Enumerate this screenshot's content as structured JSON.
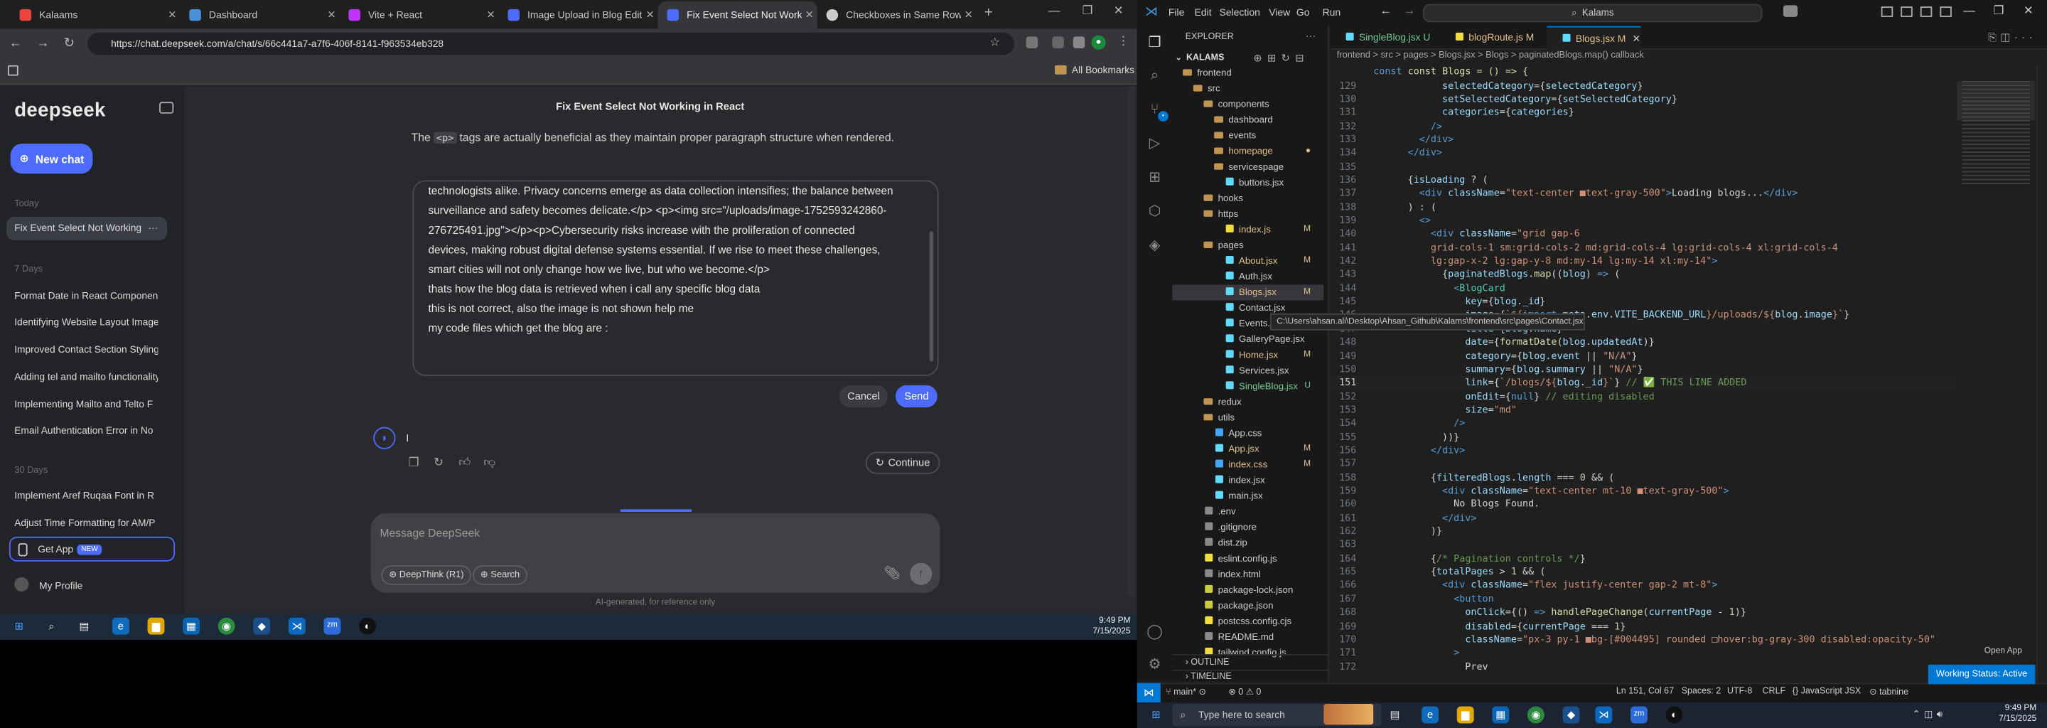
{
  "chrome": {
    "tabs": [
      {
        "title": "Kalaams",
        "color": "#e8453c"
      },
      {
        "title": "Dashboard",
        "color": "#4a90d9"
      },
      {
        "title": "Vite + React",
        "color": "#bd34fe"
      },
      {
        "title": "Image Upload in Blog Editor",
        "color": "#4d6bfe"
      },
      {
        "title": "Fix Event Select Not Working",
        "color": "#4d6bfe"
      },
      {
        "title": "Checkboxes in Same Row",
        "color": "#cccccc"
      }
    ],
    "url": "https://chat.deepseek.com/a/chat/s/66c441a7-a7f6-406f-8141-f963534eb328",
    "bookmarks_label": "All Bookmarks"
  },
  "deepseek": {
    "logo": "deepseek",
    "new_chat": "New chat",
    "groups": {
      "today": "Today",
      "week": "7 Days",
      "month": "30 Days"
    },
    "history_today": [
      "Fix Event Select Not Working"
    ],
    "history_week": [
      "Format Date in React Component",
      "Identifying Website Layout Images",
      "Improved Contact Section Styling",
      "Adding tel and mailto functionality",
      "Implementing Mailto and Telto F",
      "Email Authentication Error in No"
    ],
    "history_month": [
      "Implement Aref Ruqaa Font in R",
      "Adjust Time Formatting for AM/P"
    ],
    "get_app": "Get App",
    "get_app_badge": "NEW",
    "profile": "My Profile",
    "chat_title": "Fix Event Select Not Working in React",
    "top_text_a": "The",
    "top_code": "<p>",
    "top_text_b": "tags are actually beneficial as they maintain proper paragraph structure when rendered.",
    "edit_lines": [
      "technologists alike. Privacy concerns emerge as data collection intensifies; the balance between",
      "surveillance and safety becomes delicate.</p> <p><img src=\"/uploads/image-1752593242860-",
      "276725491.jpg\"></p><p>Cybersecurity risks increase with the proliferation of connected",
      "devices, making robust digital defense systems essential.  If we rise to meet these challenges,",
      "smart cities will not only change how we live, but who we become.</p>",
      "thats how the blog data is retrieved when i call any specific blog data",
      "this is not correct, also the image is not shown help me",
      "my code files which get the blog are :"
    ],
    "cancel": "Cancel",
    "send": "Send",
    "ai_stream": "I",
    "continue": "Continue",
    "message_placeholder": "Message DeepSeek",
    "deepthink": "DeepThink (R1)",
    "search": "Search",
    "disclaimer": "AI-generated, for reference only"
  },
  "taskbar_left": {
    "time": "9:49 PM",
    "date": "7/15/2025"
  },
  "vscode": {
    "menu": [
      "File",
      "Edit",
      "Selection",
      "View",
      "Go",
      "Run"
    ],
    "search": "Kalams",
    "explorer_title": "EXPLORER",
    "root": "KALAMS",
    "tree": [
      {
        "name": "frontend",
        "type": "folder",
        "indent": 1
      },
      {
        "name": "src",
        "type": "folder",
        "indent": 2
      },
      {
        "name": "components",
        "type": "folder",
        "indent": 3
      },
      {
        "name": "dashboard",
        "type": "folder",
        "indent": 4
      },
      {
        "name": "events",
        "type": "folder",
        "indent": 4
      },
      {
        "name": "homepage",
        "type": "folder",
        "indent": 4,
        "status": "mod"
      },
      {
        "name": "servicespage",
        "type": "folder",
        "indent": 4
      },
      {
        "name": "buttons.jsx",
        "type": "file",
        "indent": 4
      },
      {
        "name": "hooks",
        "type": "folder",
        "indent": 3
      },
      {
        "name": "https",
        "type": "folder",
        "indent": 3
      },
      {
        "name": "index.js",
        "type": "file",
        "indent": 4,
        "status": "mod",
        "mark": "M"
      },
      {
        "name": "pages",
        "type": "folder",
        "indent": 3
      },
      {
        "name": "About.jsx",
        "type": "file",
        "indent": 4,
        "status": "mod",
        "mark": "M"
      },
      {
        "name": "Auth.jsx",
        "type": "file",
        "indent": 4
      },
      {
        "name": "Blogs.jsx",
        "type": "file",
        "indent": 4,
        "status": "mod",
        "mark": "M",
        "selected": true
      },
      {
        "name": "Contact.jsx",
        "type": "file",
        "indent": 4
      },
      {
        "name": "Events.jsx",
        "type": "file",
        "indent": 4
      },
      {
        "name": "GalleryPage.jsx",
        "type": "file",
        "indent": 4
      },
      {
        "name": "Home.jsx",
        "type": "file",
        "indent": 4,
        "status": "mod",
        "mark": "M"
      },
      {
        "name": "Services.jsx",
        "type": "file",
        "indent": 4
      },
      {
        "name": "SingleBlog.jsx",
        "type": "file",
        "indent": 4,
        "status": "unt",
        "mark": "U"
      },
      {
        "name": "redux",
        "type": "folder",
        "indent": 3
      },
      {
        "name": "utils",
        "type": "folder",
        "indent": 3
      },
      {
        "name": "App.css",
        "type": "file",
        "indent": 3
      },
      {
        "name": "App.jsx",
        "type": "file",
        "indent": 3,
        "status": "mod",
        "mark": "M"
      },
      {
        "name": "index.css",
        "type": "file",
        "indent": 3,
        "status": "mod",
        "mark": "M"
      },
      {
        "name": "index.jsx",
        "type": "file",
        "indent": 3
      },
      {
        "name": "main.jsx",
        "type": "file",
        "indent": 3
      },
      {
        "name": ".env",
        "type": "file",
        "indent": 2
      },
      {
        "name": ".gitignore",
        "type": "file",
        "indent": 2
      },
      {
        "name": "dist.zip",
        "type": "file",
        "indent": 2
      },
      {
        "name": "eslint.config.js",
        "type": "file",
        "indent": 2
      },
      {
        "name": "index.html",
        "type": "file",
        "indent": 2
      },
      {
        "name": "package-lock.json",
        "type": "file",
        "indent": 2
      },
      {
        "name": "package.json",
        "type": "file",
        "indent": 2
      },
      {
        "name": "postcss.config.cjs",
        "type": "file",
        "indent": 2
      },
      {
        "name": "README.md",
        "type": "file",
        "indent": 2
      },
      {
        "name": "tailwind.config.js",
        "type": "file",
        "indent": 2
      }
    ],
    "outline": "OUTLINE",
    "timeline": "TIMELINE",
    "tabs": [
      {
        "name": "SingleBlog.jsx",
        "mark": "U"
      },
      {
        "name": "blogRoute.js",
        "mark": "M"
      },
      {
        "name": "Blogs.jsx",
        "mark": "M"
      }
    ],
    "breadcrumb": "frontend > src > pages > Blogs.jsx > Blogs > paginatedBlogs.map() callback",
    "code_header": "const Blogs = () => {",
    "code": [
      {
        "n": "129",
        "html": "            <span class='at'>selectedCategory</span>={<span class='at'>selectedCategory</span>}"
      },
      {
        "n": "130",
        "html": "            <span class='at'>setSelectedCategory</span>={<span class='at'>setSelectedCategory</span>}"
      },
      {
        "n": "131",
        "html": "            <span class='at'>categories</span>={<span class='at'>categories</span>}"
      },
      {
        "n": "132",
        "html": "          <span class='kw'>/&gt;</span>"
      },
      {
        "n": "133",
        "html": "        <span class='kw'>&lt;/</span><span class='kw'>div</span><span class='kw'>&gt;</span>"
      },
      {
        "n": "134",
        "html": "      <span class='kw'>&lt;/</span><span class='kw'>div</span><span class='kw'>&gt;</span>"
      },
      {
        "n": "135",
        "html": ""
      },
      {
        "n": "136",
        "html": "      {<span class='at'>isLoading</span> ? ("
      },
      {
        "n": "137",
        "html": "        <span class='kw'>&lt;div</span> <span class='at'>className</span>=<span class='str'>\"text-center ■text-gray-500\"</span><span class='kw'>&gt;</span>Loading blogs...<span class='kw'>&lt;/div&gt;</span>"
      },
      {
        "n": "138",
        "html": "      ) : ("
      },
      {
        "n": "139",
        "html": "        <span class='kw'>&lt;&gt;</span>"
      },
      {
        "n": "140",
        "html": "          <span class='kw'>&lt;div</span> <span class='at'>className</span>=<span class='str'>\"grid gap-6</span>"
      },
      {
        "n": "141",
        "html": "<span class='str'>          grid-cols-1 sm:grid-cols-2 md:grid-cols-4 lg:grid-cols-4 xl:grid-cols-4</span>"
      },
      {
        "n": "142",
        "html": "<span class='str'>          lg:gap-x-2 lg:gap-y-8 md:my-14 lg:my-14 xl:my-14\"</span><span class='kw'>&gt;</span>"
      },
      {
        "n": "143",
        "html": "            {<span class='at'>paginatedBlogs</span>.<span class='fn'>map</span>((<span class='at'>blog</span>) <span class='kw'>=&gt;</span> ("
      },
      {
        "n": "144",
        "html": "              <span class='kw'>&lt;</span><span class='tag'>BlogCard</span>"
      },
      {
        "n": "145",
        "html": "                <span class='at'>key</span>={<span class='at'>blog</span>.<span class='at'>_id</span>}"
      },
      {
        "n": "146",
        "html": "                <span class='at'>image</span>={<span class='str'>`${</span><span class='kw'>import</span>.<span class='at'>meta</span>.<span class='at'>env</span>.<span class='at'>VITE_BACKEND_URL</span><span class='str'>}/uploads/${</span><span class='at'>blog</span>.<span class='at'>image</span><span class='str'>}`</span>}"
      },
      {
        "n": "147",
        "html": "                <span class='at'>title</span>={<span class='at'>blog</span>.<span class='at'>name</span>}"
      },
      {
        "n": "148",
        "html": "                <span class='at'>date</span>={<span class='fn'>formatDate</span>(<span class='at'>blog</span>.<span class='at'>updatedAt</span>)}"
      },
      {
        "n": "149",
        "html": "                <span class='at'>category</span>={<span class='at'>blog</span>.<span class='at'>event</span> || <span class='str'>\"N/A\"</span>}"
      },
      {
        "n": "150",
        "html": "                <span class='at'>summary</span>={<span class='at'>blog</span>.<span class='at'>summary</span> || <span class='str'>\"N/A\"</span>}"
      },
      {
        "n": "151",
        "html": "                <span class='at'>link</span>={<span class='str'>`/blogs/${</span><span class='at'>blog</span>.<span class='at'>_id</span><span class='str'>}`</span>} <span class='cm'>// ✅ THIS LINE ADDED</span>",
        "current": true
      },
      {
        "n": "152",
        "html": "                <span class='at'>onEdit</span>={<span class='kw'>null</span>} <span class='cm'>// editing disabled</span>"
      },
      {
        "n": "153",
        "html": "                <span class='at'>size</span>=<span class='str'>\"md\"</span>"
      },
      {
        "n": "154",
        "html": "              <span class='kw'>/&gt;</span>"
      },
      {
        "n": "155",
        "html": "            ))}"
      },
      {
        "n": "156",
        "html": "          <span class='kw'>&lt;/div&gt;</span>"
      },
      {
        "n": "157",
        "html": ""
      },
      {
        "n": "158",
        "html": "          {<span class='at'>filteredBlogs</span>.<span class='at'>length</span> === <span class='num'>0</span> &amp;&amp; ("
      },
      {
        "n": "159",
        "html": "            <span class='kw'>&lt;div</span> <span class='at'>className</span>=<span class='str'>\"text-center mt-10 ■text-gray-500\"</span><span class='kw'>&gt;</span>"
      },
      {
        "n": "160",
        "html": "              No Blogs Found."
      },
      {
        "n": "161",
        "html": "            <span class='kw'>&lt;/div&gt;</span>"
      },
      {
        "n": "162",
        "html": "          )}"
      },
      {
        "n": "163",
        "html": ""
      },
      {
        "n": "164",
        "html": "          {<span class='cm'>/* Pagination controls */</span>}"
      },
      {
        "n": "165",
        "html": "          {<span class='at'>totalPages</span> &gt; <span class='num'>1</span> &amp;&amp; ("
      },
      {
        "n": "166",
        "html": "            <span class='kw'>&lt;div</span> <span class='at'>className</span>=<span class='str'>\"flex justify-center gap-2 mt-8\"</span><span class='kw'>&gt;</span>"
      },
      {
        "n": "167",
        "html": "              <span class='kw'>&lt;button</span>"
      },
      {
        "n": "168",
        "html": "                <span class='at'>onClick</span>={() <span class='kw'>=&gt;</span> <span class='fn'>handlePageChange</span>(<span class='at'>currentPage</span> - <span class='num'>1</span>)}"
      },
      {
        "n": "169",
        "html": "                <span class='at'>disabled</span>={<span class='at'>currentPage</span> === <span class='num'>1</span>}"
      },
      {
        "n": "170",
        "html": "                <span class='at'>className</span>=<span class='str'>\"px-3 py-1 ■bg-[#004495] rounded □hover:bg-gray-300 disabled:opacity-50\"</span>"
      },
      {
        "n": "171",
        "html": "              <span class='kw'>&gt;</span>"
      },
      {
        "n": "172",
        "html": "                Prev"
      }
    ],
    "tooltip": "C:\\Users\\ahsan.ali\\Desktop\\Ahsan_Github\\Kalams\\frontend\\src\\pages\\Contact.jsx",
    "status_left": "main*",
    "status_errors": "0 ⚠ 0",
    "status_pos": "Ln 151, Col 67",
    "status_spaces": "Spaces: 2",
    "status_enc": "UTF-8",
    "status_eol": "CRLF",
    "status_lang": "JavaScript JSX",
    "status_ext": "tabnine",
    "open_app": "Open App",
    "toast": "Working Status: Active"
  },
  "taskbar_right": {
    "search": "Type here to search",
    "time": "9:49 PM",
    "date": "7/15/2025"
  }
}
